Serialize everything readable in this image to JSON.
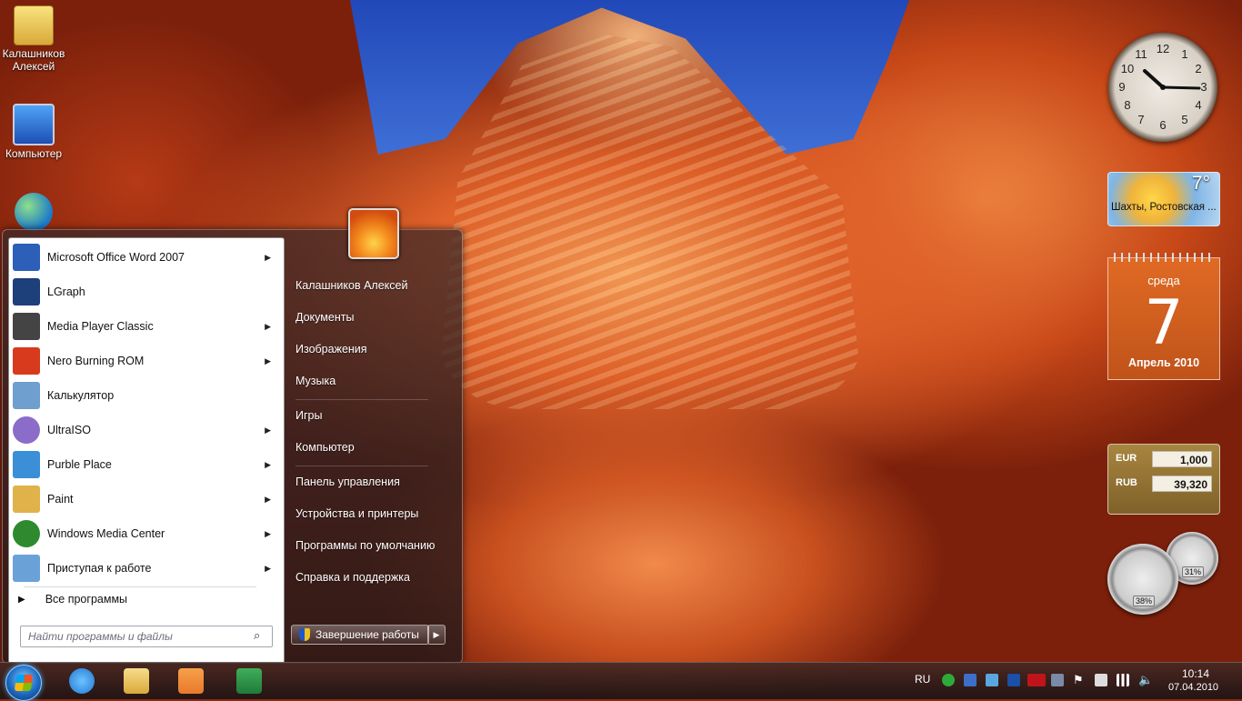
{
  "desktop": {
    "icons": [
      {
        "label": "Калашников Алексей",
        "icon": "user-folder-icon"
      },
      {
        "label": "Компьютер",
        "icon": "computer-icon"
      },
      {
        "label": "",
        "icon": "network-globe-icon"
      }
    ]
  },
  "start_menu": {
    "programs": [
      {
        "label": "Microsoft Office Word 2007",
        "icon": "word-icon",
        "has_submenu": true,
        "color": "#2b5fb8"
      },
      {
        "label": "LGraph",
        "icon": "lgraph-icon",
        "has_submenu": false,
        "color": "#1d3f7a"
      },
      {
        "label": "Media Player Classic",
        "icon": "media-player-classic-icon",
        "has_submenu": true,
        "color": "#444444"
      },
      {
        "label": "Nero Burning ROM",
        "icon": "nero-icon",
        "has_submenu": true,
        "color": "#d83a1e"
      },
      {
        "label": "Калькулятор",
        "icon": "calculator-icon",
        "has_submenu": false,
        "color": "#6e9fcf"
      },
      {
        "label": "UltraISO",
        "icon": "ultraiso-icon",
        "has_submenu": true,
        "color": "#8c6cc9"
      },
      {
        "label": "Purble Place",
        "icon": "purble-place-icon",
        "has_submenu": true,
        "color": "#3b8fd6"
      },
      {
        "label": "Paint",
        "icon": "paint-icon",
        "has_submenu": true,
        "color": "#e0b24a"
      },
      {
        "label": "Windows Media Center",
        "icon": "media-center-icon",
        "has_submenu": true,
        "color": "#2e8a2e"
      },
      {
        "label": "Приступая к работе",
        "icon": "getting-started-icon",
        "has_submenu": true,
        "color": "#6aa2d8"
      }
    ],
    "all_programs": "Все программы",
    "search_placeholder": "Найти программы и файлы",
    "right_items": [
      "Калашников Алексей",
      "Документы",
      "Изображения",
      "Музыка",
      "Игры",
      "Компьютер",
      "Панель управления",
      "Устройства и принтеры",
      "Программы по умолчанию",
      "Справка и поддержка"
    ],
    "shutdown_label": "Завершение работы"
  },
  "gadgets": {
    "clock": {
      "numerals": [
        "12",
        "1",
        "2",
        "3",
        "4",
        "5",
        "6",
        "7",
        "8",
        "9",
        "10",
        "11"
      ],
      "time": "10:14"
    },
    "weather": {
      "temperature": "7°",
      "location": "Шахты, Ростовская ..."
    },
    "calendar": {
      "weekday": "среда",
      "day": "7",
      "month_year": "Апрель 2010"
    },
    "currency": [
      {
        "code": "EUR",
        "value": "1,000"
      },
      {
        "code": "RUB",
        "value": "39,320"
      }
    ],
    "meters": {
      "cpu": "38%",
      "memory": "31%"
    }
  },
  "taskbar": {
    "pinned": [
      {
        "icon": "internet-explorer-icon",
        "color": "#1f78d1"
      },
      {
        "icon": "file-explorer-icon",
        "color": "#e9c25a"
      },
      {
        "icon": "media-player-icon",
        "color": "#e8792c"
      },
      {
        "icon": "excel-icon",
        "color": "#1f7a3a"
      }
    ],
    "language": "RU",
    "time": "10:14",
    "date": "07.04.2010"
  }
}
